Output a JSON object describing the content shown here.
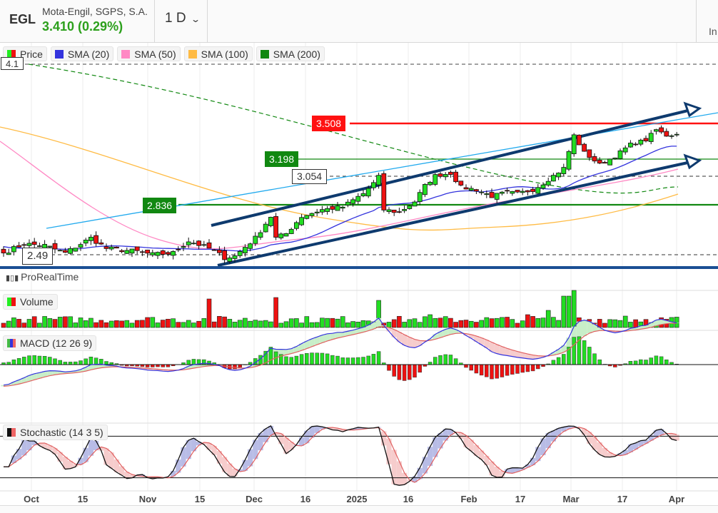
{
  "header": {
    "symbol": "EGL",
    "name": "Mota-Engil, SGPS, S.A.",
    "price": "3.410 (0.29%)",
    "period": "1 D",
    "right_label": "In"
  },
  "legend": [
    {
      "label": "Price",
      "color": "#22dd22"
    },
    {
      "label": "SMA (20)",
      "color": "#3333cc"
    },
    {
      "label": "SMA (50)",
      "color": "#ff88bb"
    },
    {
      "label": "SMA (100)",
      "color": "#ffbb44"
    },
    {
      "label": "SMA (200)",
      "color": "#118811"
    }
  ],
  "levels": {
    "top": "4.1",
    "red": "3.508",
    "green_high": "3.198",
    "dashed_mid": "3.054",
    "green_low": "2.836",
    "dashed_low": "2.49"
  },
  "branding": "ProRealTime",
  "panels": {
    "volume": "Volume",
    "macd": "MACD (12 26 9)",
    "stochastic": "Stochastic (14 3 5)"
  },
  "x_axis": [
    "Oct",
    "15",
    "Nov",
    "15",
    "Dec",
    "16",
    "2025",
    "16",
    "Feb",
    "17",
    "Mar",
    "17",
    "Apr"
  ],
  "colors": {
    "up": "#22dd22",
    "down": "#ee1111",
    "channel": "#0e3a6e",
    "trend": "#22aaee",
    "red_level": "#ff1111",
    "green_level": "#118811"
  },
  "chart_data": {
    "type": "candlestick",
    "ylim": [
      2.45,
      4.15
    ],
    "key_closes": [
      [
        0,
        2.5
      ],
      [
        4,
        2.56
      ],
      [
        8,
        2.55
      ],
      [
        12,
        2.5
      ],
      [
        17,
        2.6
      ],
      [
        20,
        2.53
      ],
      [
        26,
        2.51
      ],
      [
        29,
        2.49
      ],
      [
        33,
        2.5
      ],
      [
        36,
        2.58
      ],
      [
        40,
        2.53
      ],
      [
        43,
        2.47
      ],
      [
        45,
        2.48
      ],
      [
        49,
        2.6
      ],
      [
        52,
        2.75
      ],
      [
        53,
        2.6
      ],
      [
        55,
        2.63
      ],
      [
        58,
        2.75
      ],
      [
        62,
        2.8
      ],
      [
        66,
        2.82
      ],
      [
        70,
        2.92
      ],
      [
        72,
        3.0
      ],
      [
        73,
        3.05
      ],
      [
        74,
        2.8
      ],
      [
        77,
        2.78
      ],
      [
        80,
        2.86
      ],
      [
        82,
        2.98
      ],
      [
        84,
        3.06
      ],
      [
        87,
        3.08
      ],
      [
        89,
        2.97
      ],
      [
        92,
        2.95
      ],
      [
        95,
        2.9
      ],
      [
        98,
        2.93
      ],
      [
        100,
        2.92
      ],
      [
        103,
        2.95
      ],
      [
        105,
        3.0
      ],
      [
        107,
        3.06
      ],
      [
        109,
        3.12
      ],
      [
        111,
        3.4
      ],
      [
        113,
        3.25
      ],
      [
        116,
        3.15
      ],
      [
        119,
        3.22
      ],
      [
        122,
        3.32
      ],
      [
        125,
        3.36
      ],
      [
        127,
        3.45
      ],
      [
        129,
        3.4
      ],
      [
        131,
        3.41
      ]
    ]
  }
}
